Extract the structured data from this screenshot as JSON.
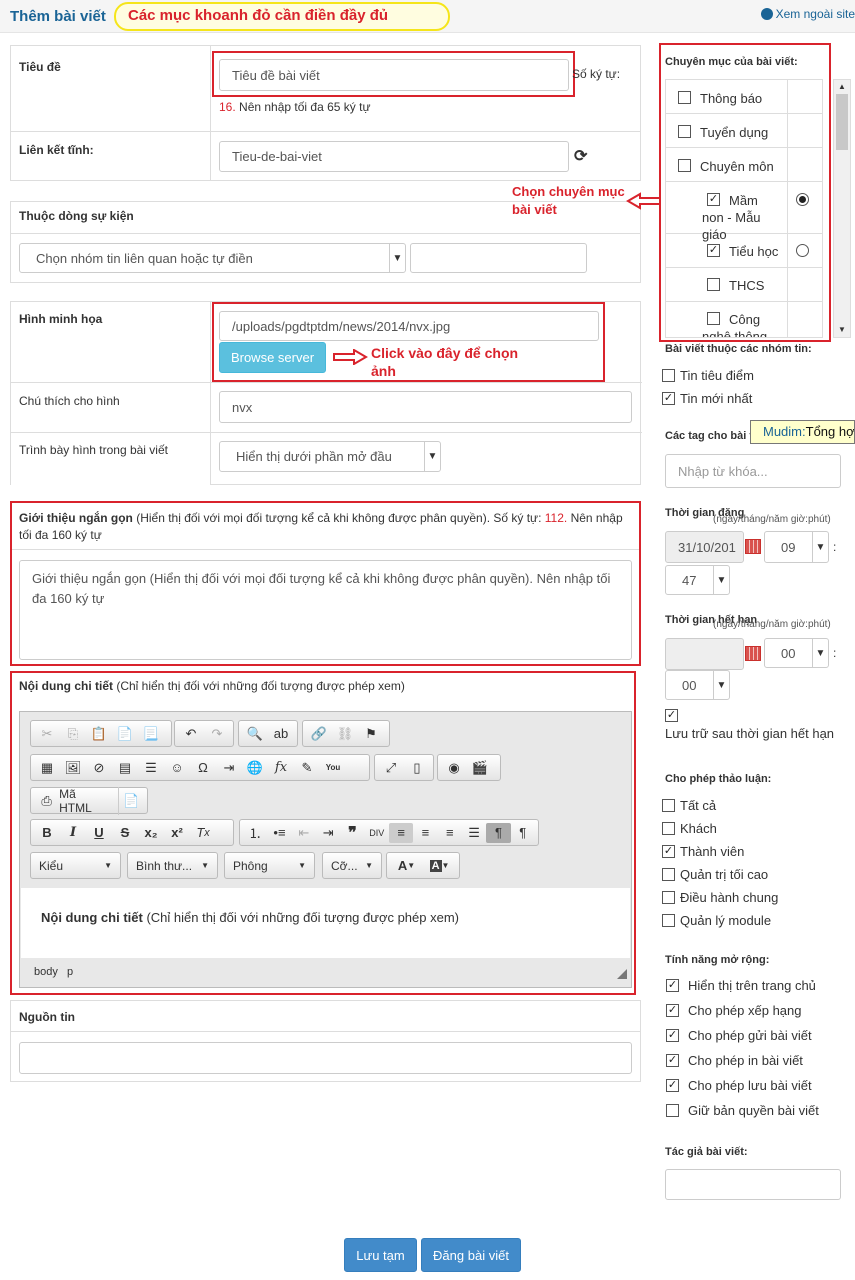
{
  "header": {
    "title": "Thêm bài viết",
    "notice": "Các mục khoanh đỏ cần điền đầy đủ",
    "view_site": "Xem ngoài site"
  },
  "form": {
    "title_label": "Tiêu đề",
    "title_value": "Tiêu đề bài viết",
    "char_count_label": "Số ký tự:",
    "char_count": "16.",
    "char_hint": "Nên nhập tối đa 65 ký tự",
    "alias_label": "Liên kết tĩnh:",
    "alias_value": "Tieu-de-bai-viet",
    "event_label": "Thuộc dòng sự kiện",
    "event_select": "Chọn nhóm tin liên quan hoặc tự điền",
    "image_label": "Hình minh họa",
    "image_value": "/uploads/pgdtptdm/news/2014/nvx.jpg",
    "browse_button": "Browse server",
    "image_annotation": "Click vào đây để chọn ảnh",
    "caption_label": "Chú thích cho hình",
    "caption_value": "nvx",
    "image_pos_label": "Trình bày hình trong bài viết",
    "image_pos_select": "Hiển thị dưới phần mở đầu",
    "intro_label_bold": "Giới thiệu ngắn gọn",
    "intro_label_rest": " (Hiển thị đối với mọi đối tượng kể cả khi không được phân quyền). Số ký tự: ",
    "intro_count": "112.",
    "intro_hint": " Nên nhập tối đa 160 ký tự",
    "intro_text": "Giới thiệu ngắn gọn (Hiển thị đối với mọi đối tượng kể cả khi không được phân quyền). Nên nhập tối đa 160 ký tự",
    "body_label_bold": "Nội dung chi tiết",
    "body_label_rest": " (Chỉ hiển thị đối với những đối tượng được phép xem)",
    "body_text_bold": "Nội dung chi tiết",
    "body_text_rest": " (Chỉ hiển thị đối với những đối tượng được phép xem)",
    "source_label": "Nguồn tin",
    "source_value": ""
  },
  "editor": {
    "html_button": "Mã HTML",
    "style_select": "Kiểu",
    "format_select": "Bình thư...",
    "font_select": "Phông",
    "size_select": "Cỡ...",
    "path": [
      "body",
      "p"
    ]
  },
  "sidebar": {
    "category_title": "Chuyên mục của bài viết:",
    "categories": [
      {
        "label": "Thông báo",
        "checked": false,
        "radio": ""
      },
      {
        "label": "Tuyển dụng",
        "checked": false,
        "radio": ""
      },
      {
        "label": "Chuyên môn",
        "checked": false,
        "radio": ""
      },
      {
        "label": "Mầm non - Mẫu giáo",
        "checked": true,
        "radio": "selected"
      },
      {
        "label": "Tiểu học",
        "checked": true,
        "radio": "empty"
      },
      {
        "label": "THCS",
        "checked": false,
        "radio": ""
      },
      {
        "label": "Công nghệ thông tin",
        "checked": false,
        "radio": ""
      }
    ],
    "category_annotation": "Chọn chuyên mục bài viết",
    "groups_title": "Bài viết thuộc các nhóm tin:",
    "groups": [
      {
        "label": "Tin tiêu điểm",
        "checked": false
      },
      {
        "label": "Tin mới nhất",
        "checked": true
      }
    ],
    "tooltip_prefix": "Mudim:",
    "tooltip_value": "Tổng hợp",
    "tags_title": "Các tag cho bài v",
    "tags_placeholder": "Nhập từ khóa...",
    "publish_title": "Thời gian đăng",
    "date_format": "(ngày/tháng/năm giờ:phút)",
    "publish_date": "31/10/201",
    "publish_hour": "09",
    "publish_minute": "47",
    "expire_title": "Thời gian hết hạn",
    "expire_hour": "00",
    "expire_minute": "00",
    "archive_label": "Lưu trữ sau thời gian hết hạn",
    "discuss_title": "Cho phép thảo luận:",
    "discuss": [
      {
        "label": "Tất cả",
        "checked": false
      },
      {
        "label": "Khách",
        "checked": false
      },
      {
        "label": "Thành viên",
        "checked": true
      },
      {
        "label": "Quản trị tối cao",
        "checked": false
      },
      {
        "label": "Điều hành chung",
        "checked": false
      },
      {
        "label": "Quản lý module",
        "checked": false
      }
    ],
    "ext_title": "Tính năng mở rộng:",
    "ext": [
      {
        "label": "Hiển thị trên trang chủ",
        "checked": true
      },
      {
        "label": "Cho phép xếp hạng",
        "checked": true
      },
      {
        "label": "Cho phép gửi bài viết",
        "checked": true
      },
      {
        "label": "Cho phép in bài viết",
        "checked": true
      },
      {
        "label": "Cho phép lưu bài viết",
        "checked": true
      },
      {
        "label": "Giữ bản quyền bài viết",
        "checked": false
      }
    ],
    "author_title": "Tác giả bài viết:",
    "author_value": ""
  },
  "actions": {
    "draft_button": "Lưu tạm",
    "publish_button": "Đăng bài viết"
  },
  "colors": {
    "accent": "#428bca",
    "annotation_red": "#d9232c",
    "highlight_yellow": "#f5e51a"
  }
}
